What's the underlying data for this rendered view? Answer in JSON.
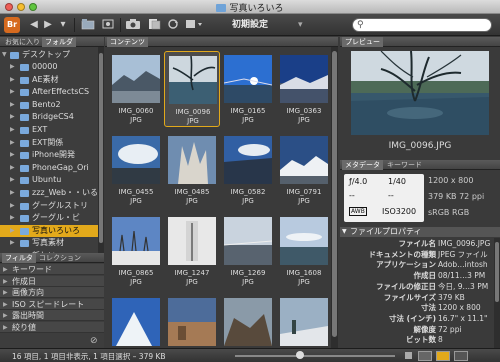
{
  "window": {
    "title": "写真いろいろ"
  },
  "toolbar": {
    "logo": "Br",
    "back_icon": "◀",
    "forward_icon": "▶",
    "menu_icon": "▾",
    "workspace": "初期設定",
    "search_placeholder": ""
  },
  "left_panel": {
    "tabs": [
      "お気に入り",
      "フォルダ"
    ],
    "root": "デスクトップ",
    "folders": [
      "00000",
      "AE素材",
      "AfterEffectsCS",
      "Bento2",
      "BridgeCS4",
      "EXT",
      "EXT関係",
      "iPhone開発",
      "PhoneGap_Ori",
      "Ubuntu",
      "zzz_Web・・いる",
      "グーグルストリ",
      "グーグル・ビ",
      "写真いろいろ",
      "写真素材",
      "新しい"
    ],
    "selected_folder": "写真いろいろ"
  },
  "filter_panel": {
    "tabs": [
      "フィルタ",
      "コレクション"
    ],
    "rows": [
      "キーワード",
      "作成日",
      "画像方向",
      "ISO スピードレート",
      "露出時間",
      "絞り値"
    ]
  },
  "content": {
    "tab": "コンテンツ",
    "thumbnails": [
      {
        "name": "IMG_0060",
        "ext": "JPG"
      },
      {
        "name": "IMG_0096",
        "ext": "JPG"
      },
      {
        "name": "IMG_0165",
        "ext": "JPG"
      },
      {
        "name": "IMG_0363",
        "ext": "JPG"
      },
      {
        "name": "IMG_0455",
        "ext": "JPG"
      },
      {
        "name": "IMG_0485",
        "ext": "JPG"
      },
      {
        "name": "IMG_0582",
        "ext": "JPG"
      },
      {
        "name": "IMG_0791",
        "ext": "JPG"
      },
      {
        "name": "IMG_0865",
        "ext": "JPG"
      },
      {
        "name": "IMG_1247",
        "ext": "JPG"
      },
      {
        "name": "IMG_1269",
        "ext": "JPG"
      },
      {
        "name": "IMG_1608",
        "ext": "JPG"
      },
      {
        "name": "",
        "ext": ""
      },
      {
        "name": "",
        "ext": ""
      },
      {
        "name": "",
        "ext": ""
      },
      {
        "name": "",
        "ext": ""
      }
    ],
    "selected_index": 1
  },
  "preview": {
    "tab": "プレビュー",
    "caption": "IMG_0096.JPG"
  },
  "metadata": {
    "tabs": [
      "メタデータ",
      "キーワード"
    ],
    "aperture": "ƒ/4.0",
    "shutter": "1/40",
    "dash": "--",
    "awb": "AWB",
    "iso": "ISO3200",
    "dimensions": "1200 x 800",
    "size_ppi": "379 KB  72 ppi",
    "color": "sRGB    RGB",
    "section": "ファイルプロパティ",
    "rows": [
      {
        "k": "ファイル名",
        "v": "IMG_0096.JPG"
      },
      {
        "k": "ドキュメントの種類",
        "v": "JPEG ファイル"
      },
      {
        "k": "アプリケーション",
        "v": "Adob…intosh"
      },
      {
        "k": "作成日",
        "v": "08/11…3 PM"
      },
      {
        "k": "ファイルの修正日",
        "v": "今日, 9…3 PM"
      },
      {
        "k": "ファイルサイズ",
        "v": "379 KB"
      },
      {
        "k": "寸法",
        "v": "1200 x 800"
      },
      {
        "k": "寸法 (インチ)",
        "v": "16.7\" x 11.1\""
      },
      {
        "k": "解像度",
        "v": "72 ppi"
      },
      {
        "k": "ビット数",
        "v": "8"
      }
    ]
  },
  "status": {
    "text": "16 項目, 1 項目非表示, 1 項目選択 – 379 KB"
  }
}
